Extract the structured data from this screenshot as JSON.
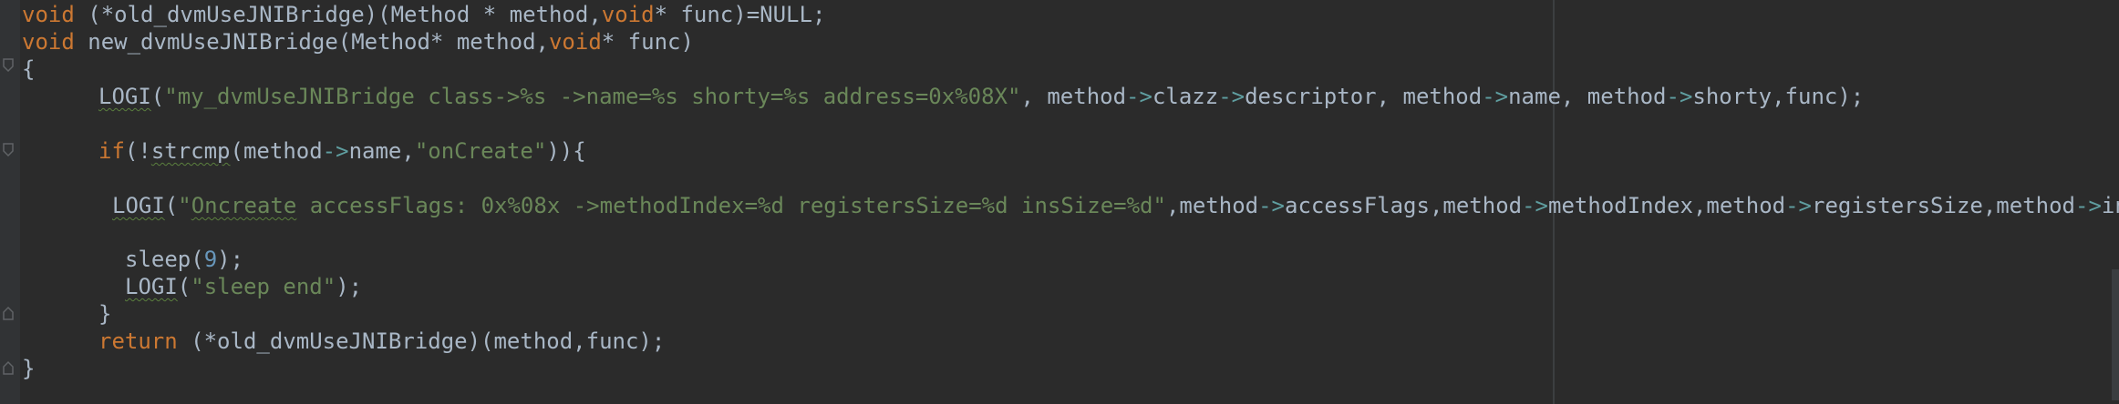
{
  "editor": {
    "lines": {
      "l1": {
        "kw1": "void",
        "t1": " (*old_dvmUseJNIBridge)(Method * method,",
        "kw2": "void",
        "t2": "* func)=NULL;"
      },
      "l2": {
        "kw1": "void",
        "t1": " new_dvmUseJNIBridge(Method* method,",
        "kw2": "void",
        "t2": "* func)"
      },
      "l3": {
        "t1": "{"
      },
      "l4": {
        "fn": "LOGI",
        "t1": "(",
        "str": "\"my_dvmUseJNIBridge class->%s ->name=%s shorty=%s address=0x%08X\"",
        "t2": ", method",
        "op1": "->",
        "t3": "clazz",
        "op2": "->",
        "t4": "descriptor, method",
        "op3": "->",
        "t5": "name, method",
        "op4": "->",
        "t6": "shorty,func);"
      },
      "l5": {
        "kw": "if",
        "t1": "(!",
        "fn": "strcmp",
        "t2": "(method",
        "op1": "->",
        "t3": "name,",
        "str": "\"onCreate\"",
        "t4": ")){"
      },
      "l6": {
        "fn": "LOGI",
        "t1": "(",
        "str_q": "\"",
        "str_u": "Oncreate",
        "str_rest": " accessFlags: 0x%08x ->methodIndex=%d registersSize=%d insSize=%d\"",
        "t2": ",method",
        "op1": "->",
        "t3": "accessFlags,method",
        "op2": "->",
        "t4": "methodIndex,method",
        "op3": "->",
        "t5": "registersSize,method",
        "op4": "->",
        "t6": "insSize"
      },
      "l7": {
        "t1": "sleep(",
        "num": "9",
        "t2": ");"
      },
      "l8": {
        "fn": "LOGI",
        "t1": "(",
        "str": "\"sleep end\"",
        "t2": ");"
      },
      "l9": {
        "t1": "}"
      },
      "l10": {
        "kw": "return",
        "t1": " (*old_dvmUseJNIBridge)(method,func);"
      },
      "l11": {
        "t1": "}"
      }
    }
  }
}
